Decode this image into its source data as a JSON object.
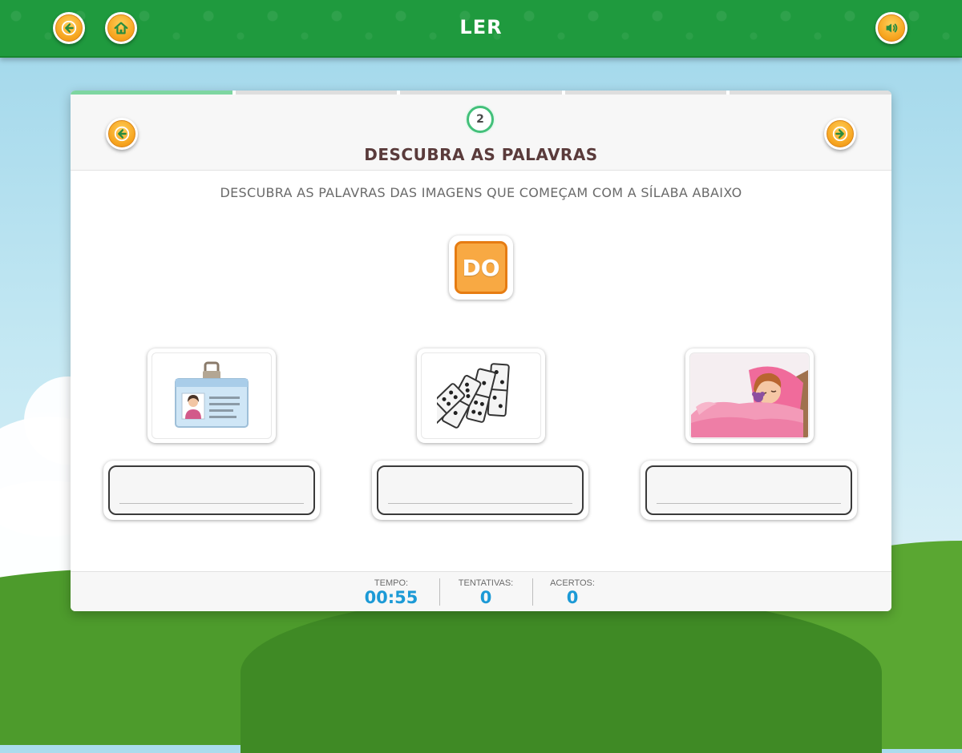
{
  "header": {
    "title": "LER"
  },
  "activity": {
    "step": "2",
    "title": "DESCUBRA AS PALAVRAS",
    "instructions": "DESCUBRA AS PALAVRAS DAS IMAGENS QUE COMEÇAM COM A SÍLABA ABAIXO",
    "syllable": "DO",
    "progress": {
      "completed_segments": 1,
      "total_segments": 5
    },
    "items": [
      {
        "image": "id-badge-image",
        "answer": ""
      },
      {
        "image": "dominoes-image",
        "answer": ""
      },
      {
        "image": "sleeping-girl-image",
        "answer": ""
      }
    ]
  },
  "stats": {
    "time_label": "TEMPO:",
    "time_value": "00:55",
    "attempts_label": "TENTATIVAS:",
    "attempts_value": "0",
    "hits_label": "ACERTOS:",
    "hits_value": "0"
  },
  "icons": {
    "back": "arrow-left-icon",
    "home": "home-icon",
    "sound": "speaker-icon",
    "prev": "arrow-left-icon",
    "next": "arrow-right-icon"
  },
  "colors": {
    "topbar": "#1f9a3e",
    "accent_orange": "#f8a943",
    "stat_blue": "#1c9ad6",
    "title_brown": "#5a3b3b",
    "progress_done": "#7ed6a1"
  }
}
